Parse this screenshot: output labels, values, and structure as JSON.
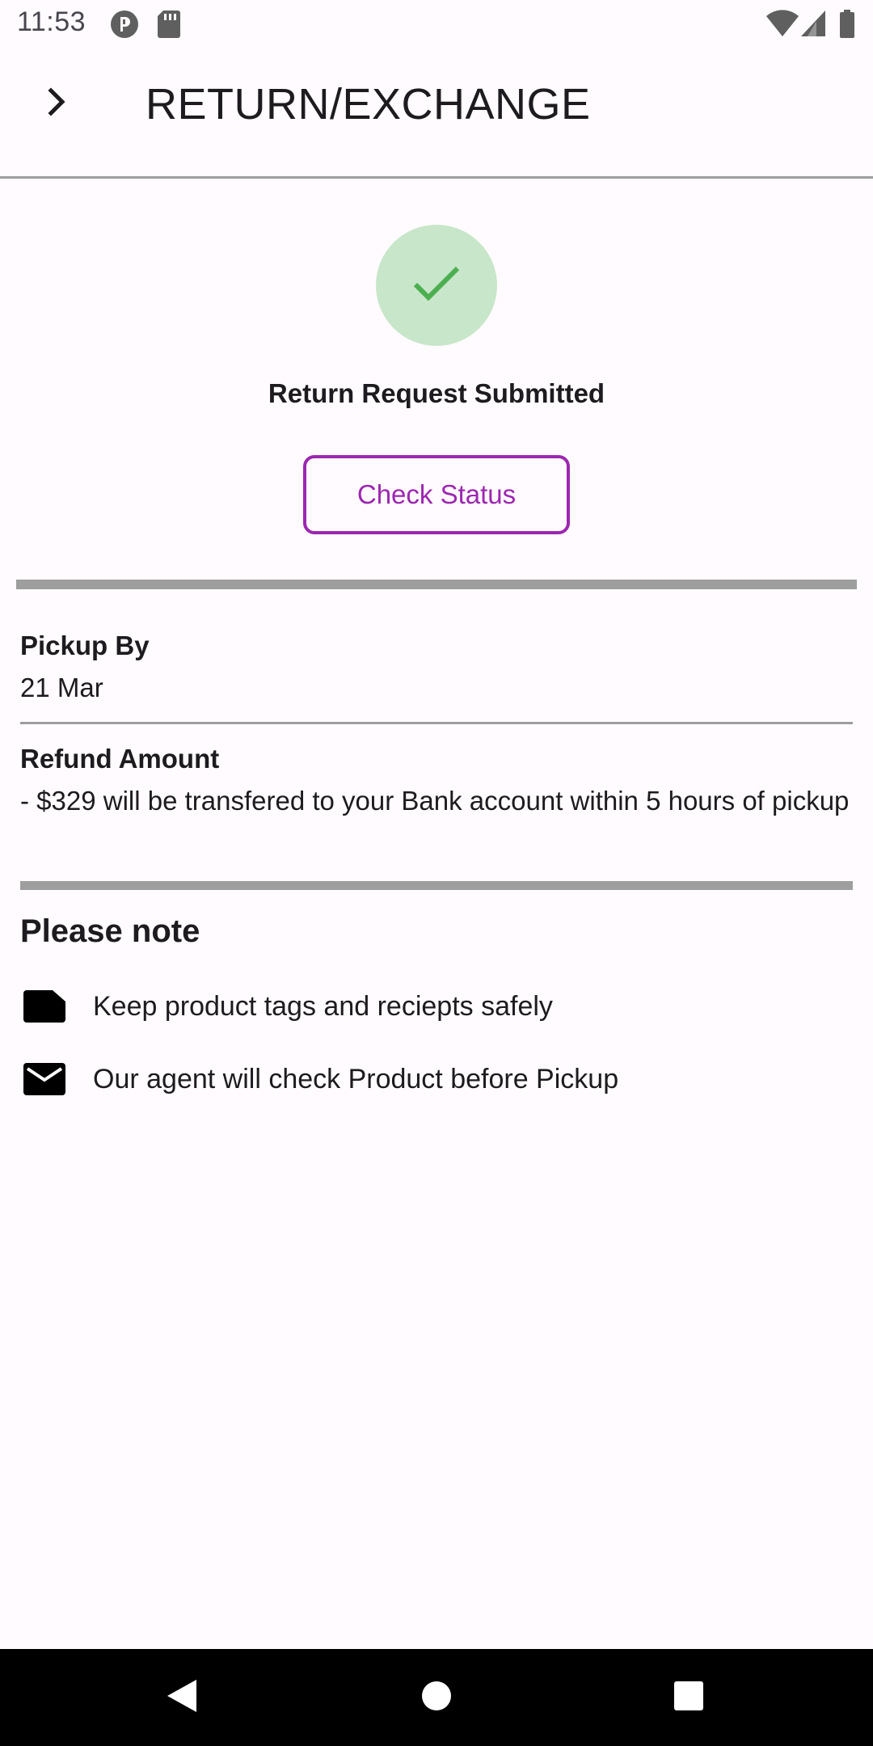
{
  "status_bar": {
    "time": "11:53",
    "left_icons": [
      "pocket-casts-icon",
      "sd-card-icon"
    ],
    "right_icons": [
      "wifi-icon",
      "cell-signal-icon",
      "battery-icon"
    ]
  },
  "app_bar": {
    "title": "RETURN/EXCHANGE",
    "back_icon": "chevron-right-icon"
  },
  "success": {
    "icon": "checkmark-icon",
    "title": "Return Request Submitted",
    "button_label": "Check Status"
  },
  "details": {
    "pickup_label": "Pickup By",
    "pickup_value": "21 Mar",
    "refund_label": "Refund Amount",
    "refund_value": "- $329 will be transfered to your Bank account within 5 hours of pickup"
  },
  "note": {
    "heading": "Please note",
    "items": [
      {
        "icon": "note-icon",
        "text": "Keep product tags and reciepts safely"
      },
      {
        "icon": "mail-icon",
        "text": "Our agent will check Product before Pickup"
      }
    ]
  },
  "nav_bar": {
    "buttons": [
      "back-triangle-icon",
      "home-circle-icon",
      "recents-square-icon"
    ]
  },
  "colors": {
    "accent": "#9c27b0",
    "success_bg": "#c8e6c9",
    "success_fg": "#4caf50",
    "divider": "#9e9e9e",
    "background": "#fffbfe"
  }
}
